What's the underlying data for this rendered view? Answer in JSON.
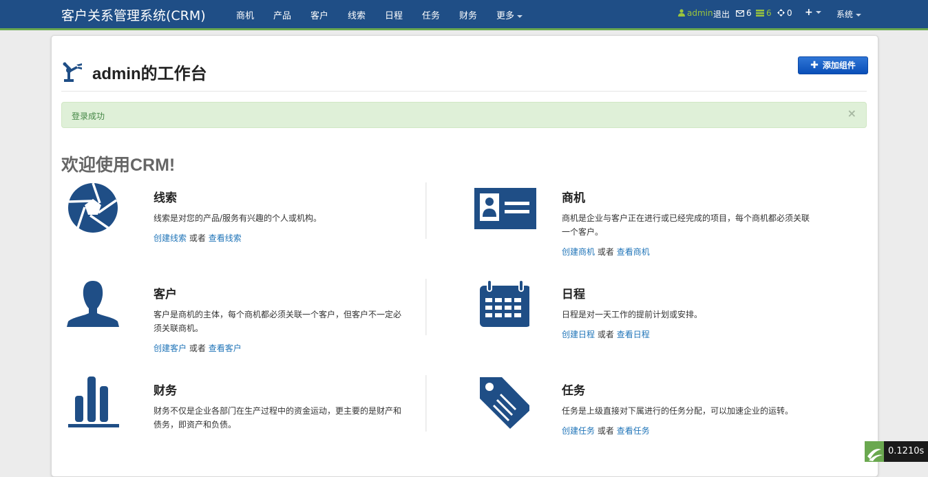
{
  "nav": {
    "brand": "客户关系管理系统(CRM)",
    "menu": [
      "商机",
      "产品",
      "客户",
      "线索",
      "日程",
      "任务",
      "财务"
    ],
    "more": "更多",
    "user": "admin",
    "logout": "退出",
    "mail_count": "6",
    "task_count": "6",
    "notify_count": "0",
    "system": "系统"
  },
  "header": {
    "title": "admin的工作台",
    "add_button": "添加组件"
  },
  "alert": {
    "message": "登录成功",
    "close": "×"
  },
  "welcome": "欢迎使用CRM!",
  "connector": "或者",
  "features": [
    {
      "icon": "aperture-icon",
      "title": "线索",
      "desc": "线索是对您的产品/服务有兴趣的个人或机构。",
      "create": "创建线索",
      "view": "查看线索"
    },
    {
      "icon": "id-card-icon",
      "title": "商机",
      "desc": "商机是企业与客户正在进行或已经完成的项目，每个商机都必须关联一个客户。",
      "create": "创建商机",
      "view": "查看商机"
    },
    {
      "icon": "user-silhouette-icon",
      "title": "客户",
      "desc": "客户是商机的主体，每个商机都必须关联一个客户，但客户不一定必须关联商机。",
      "create": "创建客户",
      "view": "查看客户"
    },
    {
      "icon": "calendar-icon",
      "title": "日程",
      "desc": "日程是对一天工作的提前计划或安排。",
      "create": "创建日程",
      "view": "查看日程"
    },
    {
      "icon": "bar-chart-icon",
      "title": "财务",
      "desc": "财务不仅是企业各部门在生产过程中的资金运动，更主要的是财产和债务，即资产和负债。",
      "create": "创建财务",
      "view": "查看财务"
    },
    {
      "icon": "tag-icon",
      "title": "任务",
      "desc": "任务是上级直接对下属进行的任务分配，可以加速企业的运转。",
      "create": "创建任务",
      "view": "查看任务"
    }
  ],
  "timer": "0.1210s",
  "colors": {
    "navbar": "#1f4e86",
    "accent_green": "#9bc53d",
    "icon_blue": "#1f4e86",
    "link": "#1f74b8"
  }
}
